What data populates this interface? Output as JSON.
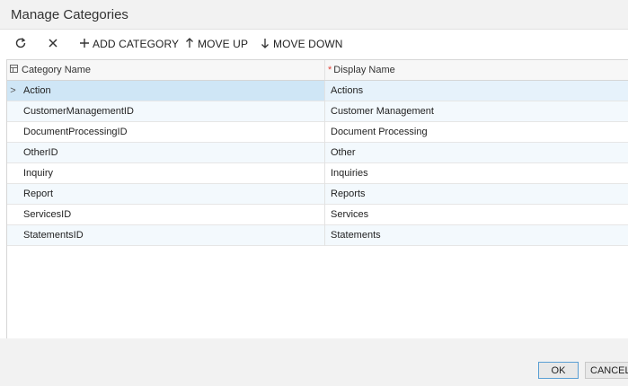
{
  "dialog": {
    "title": "Manage Categories"
  },
  "toolbar": {
    "refresh_icon": "refresh-icon",
    "delete_icon": "close-icon",
    "add_label": "ADD CATEGORY",
    "add_icon": "plus-icon",
    "move_up_label": "MOVE UP",
    "move_up_icon": "arrow-up-icon",
    "move_down_label": "MOVE DOWN",
    "move_down_icon": "arrow-down-icon"
  },
  "grid": {
    "columns": {
      "category_name": "Category Name",
      "display_name": "Display Name",
      "display_name_required_mark": "*"
    },
    "rows": [
      {
        "category": "Action",
        "display": "Actions"
      },
      {
        "category": "CustomerManagementID",
        "display": "Customer Management"
      },
      {
        "category": "DocumentProcessingID",
        "display": "Document Processing"
      },
      {
        "category": "OtherID",
        "display": "Other"
      },
      {
        "category": "Inquiry",
        "display": "Inquiries"
      },
      {
        "category": "Report",
        "display": "Reports"
      },
      {
        "category": "ServicesID",
        "display": "Services"
      },
      {
        "category": "StatementsID",
        "display": "Statements"
      }
    ],
    "selected_row_marker": ">"
  },
  "footer": {
    "ok_label": "OK",
    "cancel_label": "CANCEL"
  },
  "colors": {
    "selected_row": "#cfe6f6",
    "alt_row": "#f3f9fd",
    "required": "#e0443a",
    "ok_border": "#5a9fd4"
  }
}
